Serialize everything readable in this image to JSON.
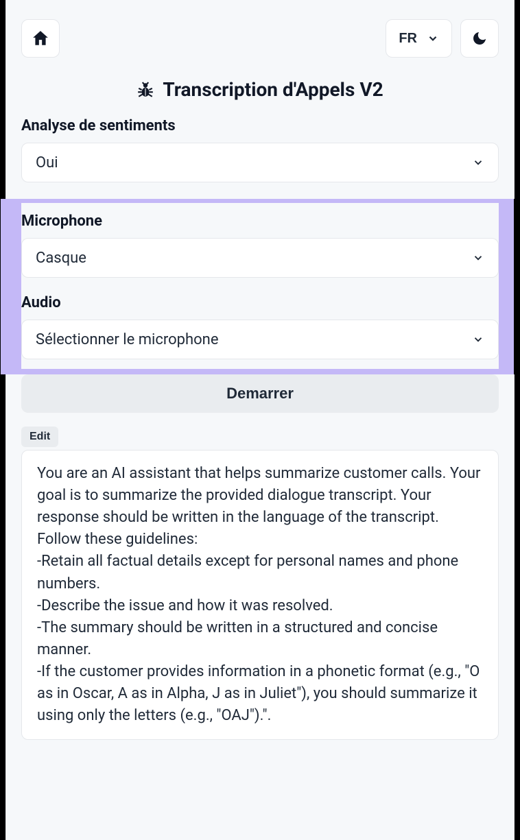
{
  "header": {
    "lang_label": "FR"
  },
  "page_title": "Transcription d'Appels V2",
  "sentiment": {
    "label": "Analyse de sentiments",
    "value": "Oui"
  },
  "microphone": {
    "label": "Microphone",
    "value": "Casque"
  },
  "audio": {
    "label": "Audio",
    "value": "Sélectionner le microphone"
  },
  "start_button": "Demarrer",
  "edit_button": "Edit",
  "prompt_text": "You are an AI assistant that helps summarize customer calls. Your goal is to summarize the provided dialogue transcript. Your response should be written in the language of the transcript.\nFollow these guidelines:\n-Retain all factual details except for personal names and phone numbers.\n-Describe the issue and how it was resolved.\n-The summary should be written in a structured and concise manner.\n-If the customer provides information in a phonetic format (e.g., \"O as in Oscar, A as in Alpha, J as in Juliet\"), you should summarize it using only the letters (e.g., \"OAJ\").\"."
}
